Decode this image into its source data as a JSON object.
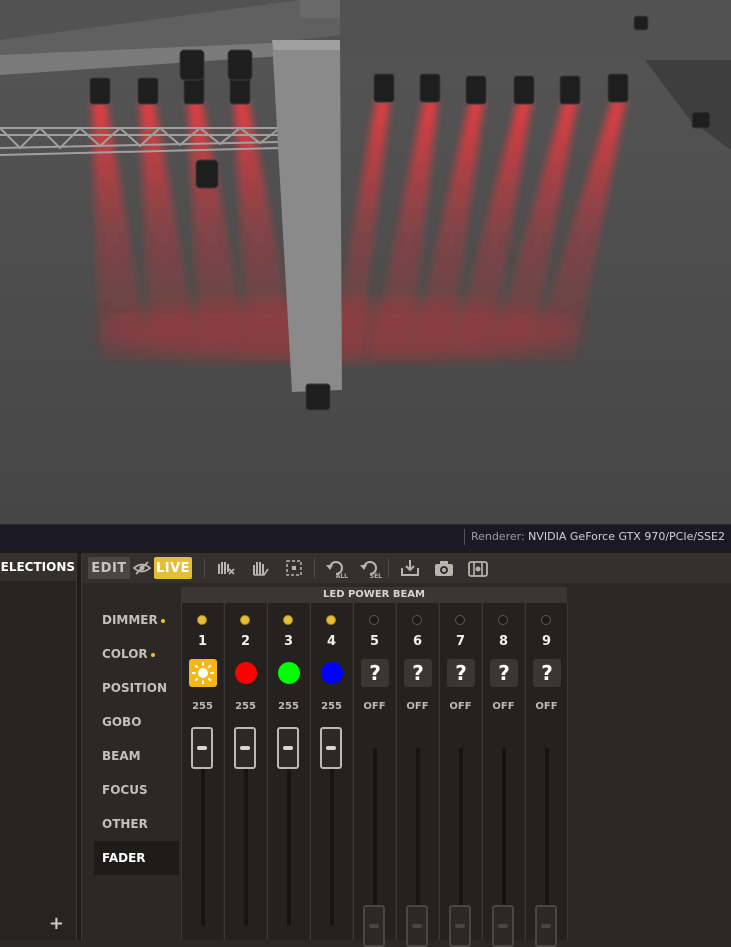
{
  "status_bar": {
    "renderer_label": "Renderer:",
    "renderer_value": "NVIDIA GeForce GTX 970/PCIe/SSE2"
  },
  "selections_panel": {
    "title": "SELECTIONS",
    "add_label": "+"
  },
  "toolbar": {
    "edit_label": "EDIT",
    "live_label": "LIVE",
    "live_color": "#e2bf37",
    "icons": [
      "hide-icon",
      "mute-icon",
      "hand-icon",
      "select-region-icon",
      "undo-all-icon",
      "undo-selection-icon",
      "import-icon",
      "camera-icon",
      "snapshot-icon"
    ],
    "undo_all_sub": "ALL",
    "undo_sel_sub": "SEL"
  },
  "categories": [
    {
      "label": "DIMMER",
      "dot": true
    },
    {
      "label": "COLOR",
      "dot": true
    },
    {
      "label": "POSITION",
      "dot": false
    },
    {
      "label": "GOBO",
      "dot": false
    },
    {
      "label": "BEAM",
      "dot": false
    },
    {
      "label": "FOCUS",
      "dot": false
    },
    {
      "label": "OTHER",
      "dot": false
    },
    {
      "label": "FADER",
      "dot": false,
      "active": true
    }
  ],
  "fixture_header": "LED POWER BEAM",
  "channels": [
    {
      "number": "1",
      "value_label": "255",
      "level": 1.0,
      "led_on": true,
      "icon": "sun",
      "color": "#f5b716"
    },
    {
      "number": "2",
      "value_label": "255",
      "level": 1.0,
      "led_on": true,
      "icon": "color",
      "color": "#ff0000"
    },
    {
      "number": "3",
      "value_label": "255",
      "level": 1.0,
      "led_on": true,
      "icon": "color",
      "color": "#00ff00"
    },
    {
      "number": "4",
      "value_label": "255",
      "level": 1.0,
      "led_on": true,
      "icon": "color",
      "color": "#0000ff"
    },
    {
      "number": "5",
      "value_label": "OFF",
      "level": 0.0,
      "led_on": false,
      "icon": "question",
      "color": "#3a3633"
    },
    {
      "number": "6",
      "value_label": "OFF",
      "level": 0.0,
      "led_on": false,
      "icon": "question",
      "color": "#3a3633"
    },
    {
      "number": "7",
      "value_label": "OFF",
      "level": 0.0,
      "led_on": false,
      "icon": "question",
      "color": "#3a3633"
    },
    {
      "number": "8",
      "value_label": "OFF",
      "level": 0.0,
      "led_on": false,
      "icon": "question",
      "color": "#3a3633"
    },
    {
      "number": "9",
      "value_label": "OFF",
      "level": 0.0,
      "led_on": false,
      "icon": "question",
      "color": "#3a3633"
    }
  ],
  "scene": {
    "beam_color": "#e0303a",
    "floor_color": "#4a4a4a",
    "truss_color": "#9a9a9a"
  }
}
